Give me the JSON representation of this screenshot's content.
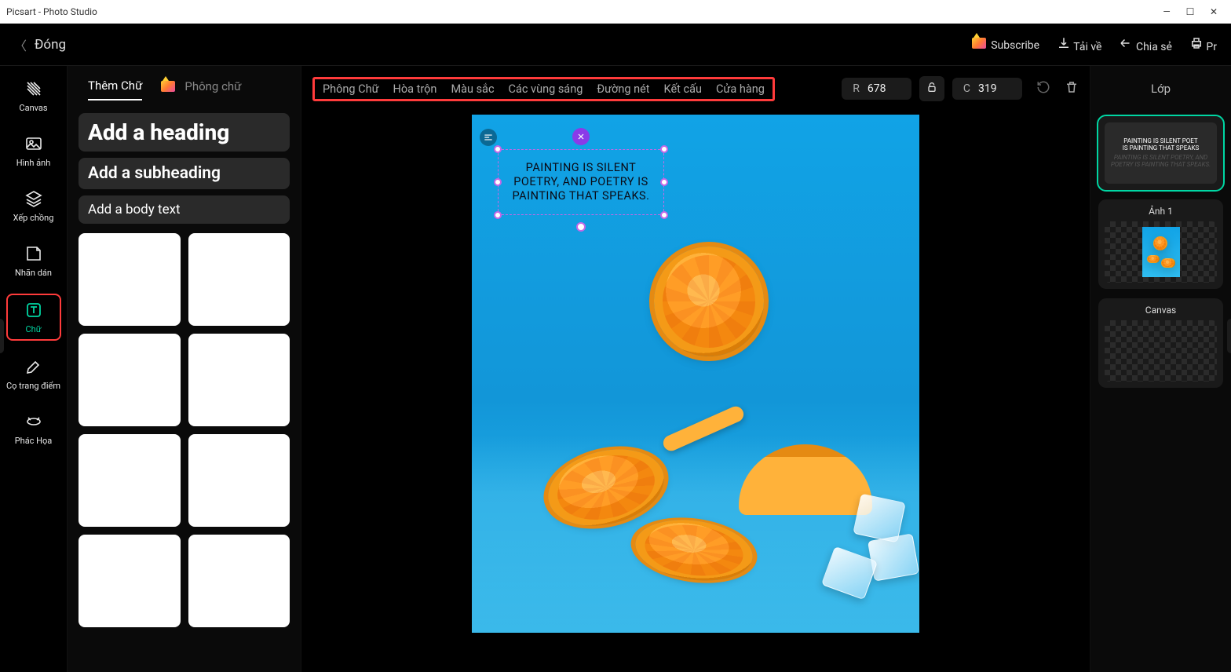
{
  "window": {
    "title": "Picsart - Photo Studio"
  },
  "topbar": {
    "close": "Đóng",
    "subscribe": "Subscribe",
    "download": "Tải về",
    "share": "Chia sẻ",
    "print": "Pr"
  },
  "rail": {
    "canvas": "Canvas",
    "image": "Hình ảnh",
    "overlay": "Xếp chồng",
    "sticker": "Nhãn dán",
    "text": "Chữ",
    "brush": "Cọ trang điểm",
    "sketch": "Phác Họa"
  },
  "panel": {
    "tab_add_text": "Thêm Chữ",
    "tab_fonts": "Phông chữ",
    "add_heading": "Add a heading",
    "add_subheading": "Add a subheading",
    "add_body": "Add a body text"
  },
  "tool_tabs": {
    "font": "Phông Chữ",
    "blend": "Hòa trộn",
    "color": "Màu sắc",
    "highlights": "Các vùng sáng",
    "outline": "Đường nét",
    "texture": "Kết cấu",
    "store": "Cửa hàng"
  },
  "coords": {
    "r_label": "R",
    "r_value": "678",
    "c_label": "C",
    "c_value": "319"
  },
  "canvas_text": "PAINTING IS SILENT POETRY, AND POETRY IS PAINTING THAT SPEAKS.",
  "layers": {
    "title": "Lớp",
    "text_layer_line1": "PAINTING IS SILENT POET",
    "text_layer_line2": "IS PAINTING THAT SPEAKS",
    "text_layer_dim": "PAINTING IS SILENT POETRY, AND POETRY IS PAINTING THAT SPEAKS.",
    "image1": "Ảnh 1",
    "canvas": "Canvas"
  }
}
